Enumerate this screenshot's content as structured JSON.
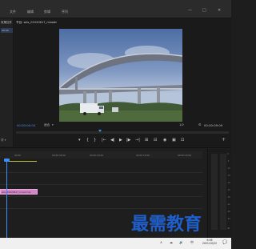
{
  "menu": {
    "items": [
      "文件",
      "编辑",
      "剪辑",
      "序列"
    ],
    "window_buttons": [
      "—",
      "□",
      "✕"
    ]
  },
  "left_panel": {
    "tab": "效果控件",
    "selected": "00:00",
    "bottom": "项 ▾"
  },
  "monitor": {
    "tab_title": "节目: wks_01020617_mixed",
    "tab_menu": "≡",
    "timecode": "00:00:00:00",
    "fit": "适合",
    "fit_arrow": "▾",
    "quality": "1/2",
    "duration": "00:00:09:09",
    "controls": [
      "▾",
      "{",
      "}",
      "|←",
      "◀|",
      "▶",
      "|▶",
      "→|",
      "⊞",
      "⊟",
      "◉",
      "▣",
      "⊡"
    ],
    "add_button": "+"
  },
  "timeline": {
    "ticks": [
      "00:00",
      "00:00:05:00",
      "00:00:10:00",
      "00:00:15:00",
      "00:00:20:00"
    ],
    "clip_label": "wks_01020617_mixed.mp"
  },
  "meter": {
    "scale": [
      "0",
      "-6",
      "-12",
      "-18",
      "-24",
      "-30",
      "-36",
      "-42",
      "-48",
      "-54",
      "dB"
    ]
  },
  "watermark": "最需教育",
  "taskbar": {
    "tray": [
      "∧",
      "☁",
      "🔊",
      "中"
    ],
    "time": "9:06",
    "date": "2021/10/22",
    "notification_icon": "💬"
  },
  "colors": {
    "accent": "#3d8ef6",
    "clip": "#d386c5",
    "workarea": "#b9b933",
    "watermark": "#1f5fcc"
  }
}
